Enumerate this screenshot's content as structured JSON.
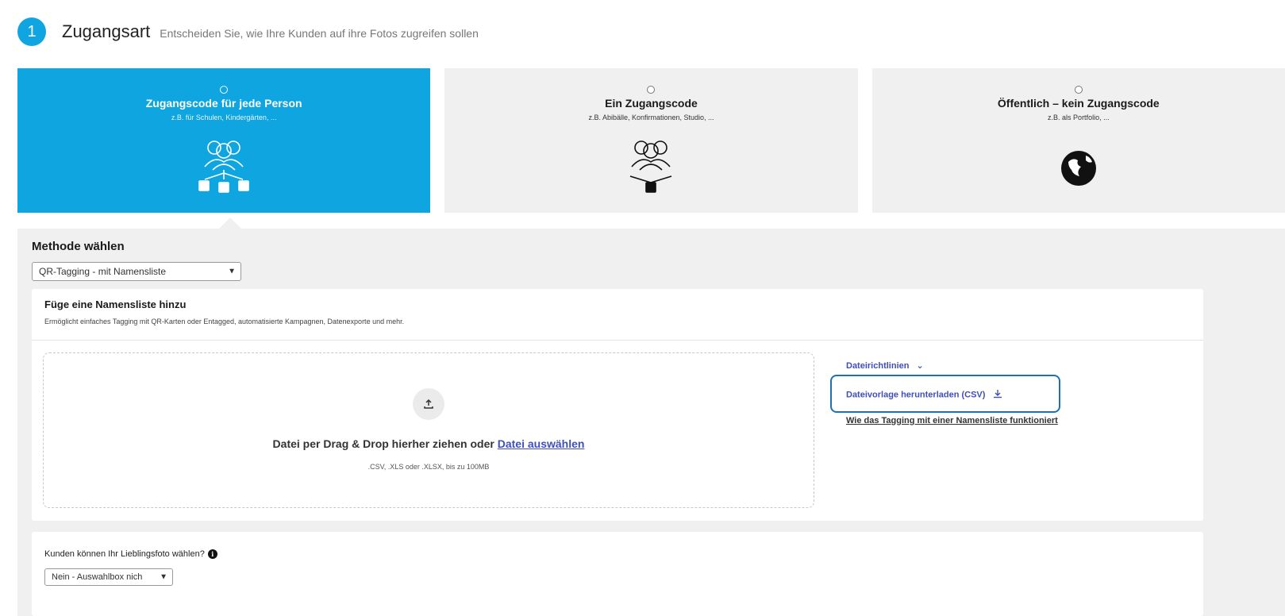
{
  "step": {
    "number": "1",
    "title": "Zugangsart",
    "subtitle": "Entscheiden Sie, wie Ihre Kunden auf ihre Fotos zugreifen sollen"
  },
  "access_cards": [
    {
      "title": "Zugangscode für jede Person",
      "subtitle": "z.B. für Schulen, Kindergärten, ...",
      "icon": "group-multi-lock-icon",
      "selected": true
    },
    {
      "title": "Ein Zugangscode",
      "subtitle": "z.B. Abibälle, Konfirmationen, Studio, ...",
      "icon": "group-single-lock-icon",
      "selected": false
    },
    {
      "title": "Öffentlich – kein Zugangscode",
      "subtitle": "z.B. als Portfolio, ...",
      "icon": "globe-icon",
      "selected": false
    }
  ],
  "method": {
    "label": "Methode wählen",
    "selected": "QR-Tagging - mit Namensliste"
  },
  "namelist": {
    "title": "Füge eine Namensliste hinzu",
    "description": "Ermöglicht einfaches Tagging mit QR-Karten oder Entagged, automatisierte Kampagnen, Datenexporte und mehr.",
    "drop_text": "Datei per Drag & Drop hierher ziehen oder",
    "drop_link": "Datei auswählen",
    "drop_hint": ".CSV, .XLS oder .XLSX, bis zu 100MB",
    "link_rules": "Dateirichtlinien",
    "link_template": "Dateivorlage herunterladen (CSV)",
    "link_howto": "Wie das Tagging mit einer Namensliste funktioniert"
  },
  "favorite": {
    "label": "Kunden können Ihr Lieblingsfoto wählen?",
    "selected": "Nein - Auswahlbox nich"
  },
  "colors": {
    "accent": "#0ea5e0",
    "link": "#3f4fb8",
    "highlight": "#1f6fb5"
  }
}
